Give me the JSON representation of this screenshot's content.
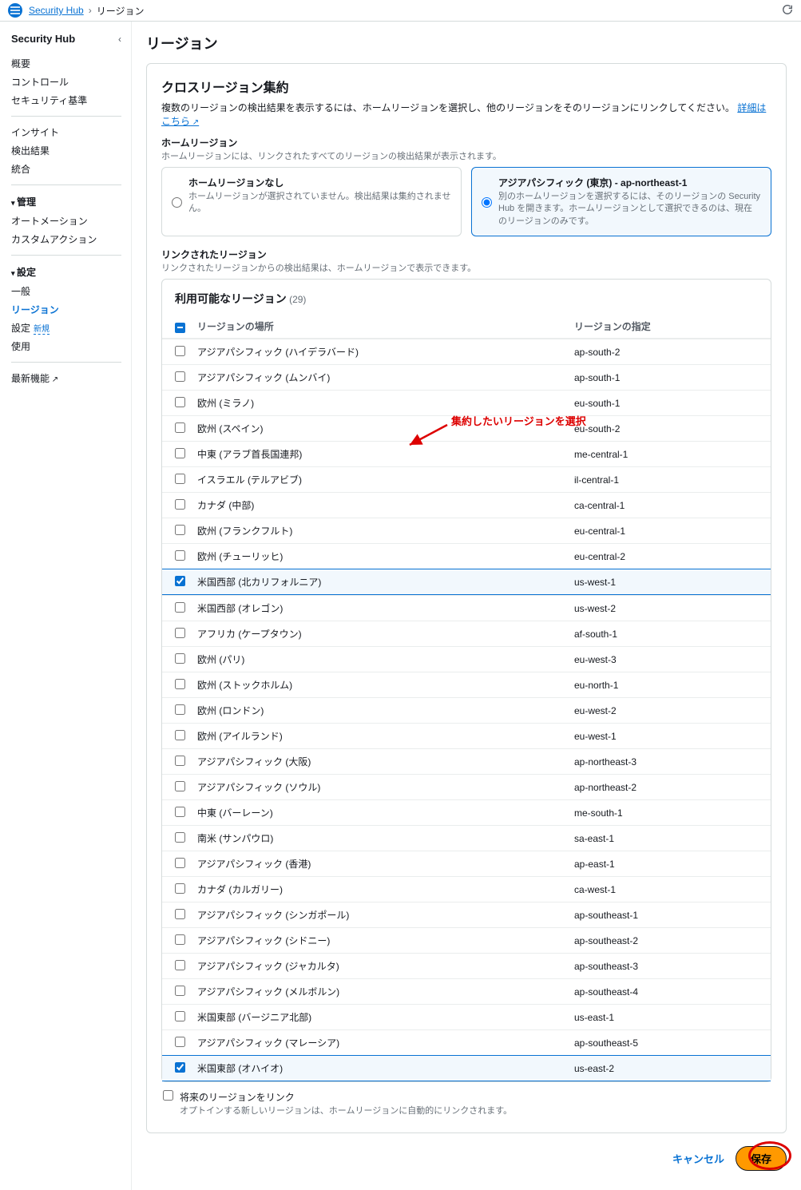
{
  "breadcrumb": {
    "root": "Security Hub",
    "current": "リージョン"
  },
  "sidebar": {
    "title": "Security Hub",
    "groups": [
      {
        "items": [
          {
            "label": "概要"
          },
          {
            "label": "コントロール"
          },
          {
            "label": "セキュリティ基準"
          }
        ]
      },
      {
        "items": [
          {
            "label": "インサイト"
          },
          {
            "label": "検出結果"
          },
          {
            "label": "統合"
          }
        ]
      },
      {
        "section": "管理",
        "items": [
          {
            "label": "オートメーション"
          },
          {
            "label": "カスタムアクション"
          }
        ]
      },
      {
        "section": "設定",
        "items": [
          {
            "label": "一般"
          },
          {
            "label": "リージョン",
            "active": true
          },
          {
            "label": "設定",
            "badge": "新規"
          },
          {
            "label": "使用"
          }
        ]
      },
      {
        "items": [
          {
            "label": "最新機能",
            "ext": true
          }
        ]
      }
    ]
  },
  "page": {
    "title": "リージョン",
    "section_title": "クロスリージョン集約",
    "section_desc": "複数のリージョンの検出結果を表示するには、ホームリージョンを選択し、他のリージョンをそのリージョンにリンクしてください。",
    "learn_more": "詳細はこちら",
    "home_label": "ホームリージョン",
    "home_desc": "ホームリージョンには、リンクされたすべてのリージョンの検出結果が表示されます。",
    "radio_a_title": "ホームリージョンなし",
    "radio_a_desc": "ホームリージョンが選択されていません。検出結果は集約されません。",
    "radio_b_title": "アジアパシフィック (東京) - ap-northeast-1",
    "radio_b_desc": "別のホームリージョンを選択するには、そのリージョンの Security Hub を開きます。ホームリージョンとして選択できるのは、現在のリージョンのみです。",
    "linked_label": "リンクされたリージョン",
    "linked_desc": "リンクされたリージョンからの検出結果は、ホームリージョンで表示できます。",
    "table_title": "利用可能なリージョン",
    "table_count": "(29)",
    "col_name": "リージョンの場所",
    "col_id": "リージョンの指定",
    "annotation": "集約したいリージョンを選択",
    "future_label": "将来のリージョンをリンク",
    "future_desc": "オプトインする新しいリージョンは、ホームリージョンに自動的にリンクされます。",
    "cancel": "キャンセル",
    "save": "保存"
  },
  "regions": [
    {
      "name": "アジアパシフィック (ハイデラバード)",
      "id": "ap-south-2",
      "checked": false
    },
    {
      "name": "アジアパシフィック (ムンバイ)",
      "id": "ap-south-1",
      "checked": false
    },
    {
      "name": "欧州 (ミラノ)",
      "id": "eu-south-1",
      "checked": false
    },
    {
      "name": "欧州 (スペイン)",
      "id": "eu-south-2",
      "checked": false
    },
    {
      "name": "中東 (アラブ首長国連邦)",
      "id": "me-central-1",
      "checked": false
    },
    {
      "name": "イスラエル (テルアビブ)",
      "id": "il-central-1",
      "checked": false
    },
    {
      "name": "カナダ (中部)",
      "id": "ca-central-1",
      "checked": false
    },
    {
      "name": "欧州 (フランクフルト)",
      "id": "eu-central-1",
      "checked": false
    },
    {
      "name": "欧州 (チューリッヒ)",
      "id": "eu-central-2",
      "checked": false
    },
    {
      "name": "米国西部 (北カリフォルニア)",
      "id": "us-west-1",
      "checked": true
    },
    {
      "name": "米国西部 (オレゴン)",
      "id": "us-west-2",
      "checked": false
    },
    {
      "name": "アフリカ (ケープタウン)",
      "id": "af-south-1",
      "checked": false
    },
    {
      "name": "欧州 (パリ)",
      "id": "eu-west-3",
      "checked": false
    },
    {
      "name": "欧州 (ストックホルム)",
      "id": "eu-north-1",
      "checked": false
    },
    {
      "name": "欧州 (ロンドン)",
      "id": "eu-west-2",
      "checked": false
    },
    {
      "name": "欧州 (アイルランド)",
      "id": "eu-west-1",
      "checked": false
    },
    {
      "name": "アジアパシフィック (大阪)",
      "id": "ap-northeast-3",
      "checked": false
    },
    {
      "name": "アジアパシフィック (ソウル)",
      "id": "ap-northeast-2",
      "checked": false
    },
    {
      "name": "中東 (バーレーン)",
      "id": "me-south-1",
      "checked": false
    },
    {
      "name": "南米 (サンパウロ)",
      "id": "sa-east-1",
      "checked": false
    },
    {
      "name": "アジアパシフィック (香港)",
      "id": "ap-east-1",
      "checked": false
    },
    {
      "name": "カナダ (カルガリー)",
      "id": "ca-west-1",
      "checked": false
    },
    {
      "name": "アジアパシフィック (シンガポール)",
      "id": "ap-southeast-1",
      "checked": false
    },
    {
      "name": "アジアパシフィック (シドニー)",
      "id": "ap-southeast-2",
      "checked": false
    },
    {
      "name": "アジアパシフィック (ジャカルタ)",
      "id": "ap-southeast-3",
      "checked": false
    },
    {
      "name": "アジアパシフィック (メルボルン)",
      "id": "ap-southeast-4",
      "checked": false
    },
    {
      "name": "米国東部 (バージニア北部)",
      "id": "us-east-1",
      "checked": false
    },
    {
      "name": "アジアパシフィック (マレーシア)",
      "id": "ap-southeast-5",
      "checked": false
    },
    {
      "name": "米国東部 (オハイオ)",
      "id": "us-east-2",
      "checked": true
    }
  ]
}
